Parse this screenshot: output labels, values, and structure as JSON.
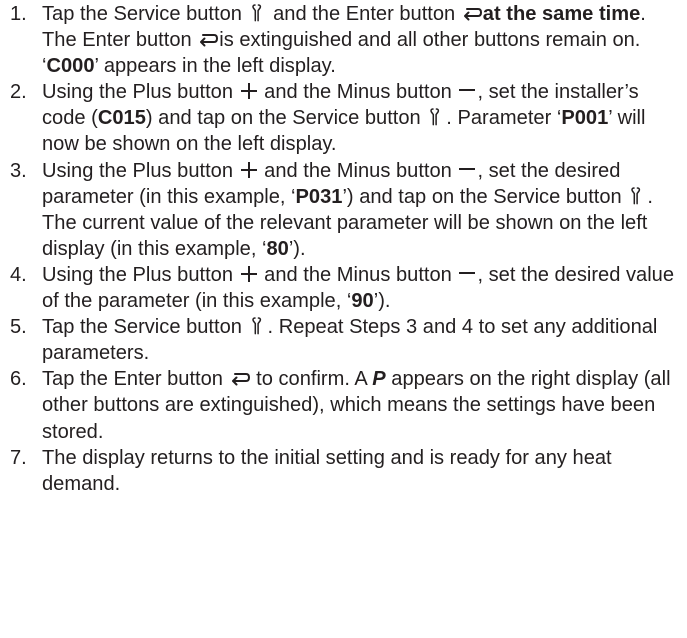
{
  "steps": [
    {
      "number": "1.",
      "parts": {
        "a": "Tap the Service button ",
        "b": " and the Enter button ",
        "c": "at the same time",
        "d": ". The Enter button ",
        "e": "is extinguished and all other buttons remain on. ‘",
        "f": "C000",
        "g": "’ appears in the left display."
      }
    },
    {
      "number": "2.",
      "parts": {
        "a": "Using the Plus button ",
        "b": " and the Minus button ",
        "c": ", set the installer’s code (",
        "d": "C015",
        "e": ") and tap on the Service button ",
        "f": ". Parameter ‘",
        "g": "P001",
        "h": "’ will now be shown on the left display."
      }
    },
    {
      "number": "3.",
      "parts": {
        "a": "Using the Plus button ",
        "b": " and the Minus button ",
        "c": ", set the desired parameter (in this example, ‘",
        "d": "P031",
        "e": "’) and tap on the Service button ",
        "f": ". The current value of the relevant parameter will be shown on the left display (in this example, ‘",
        "g": "80",
        "h": "’)."
      }
    },
    {
      "number": "4.",
      "parts": {
        "a": "Using the Plus button ",
        "b": " and the Minus button ",
        "c": ", set the desired value of the parameter (in this example, ‘",
        "d": "90",
        "e": "’)."
      }
    },
    {
      "number": "5.",
      "parts": {
        "a": "Tap the Service button ",
        "b": ". Repeat Steps 3 and 4 to set any additional parameters."
      }
    },
    {
      "number": "6.",
      "parts": {
        "a": "Tap the Enter button ",
        "b": " to confirm. A ",
        "c": "P",
        "d": " appears on the right display (all other buttons are extinguished), which means the settings have been stored."
      }
    },
    {
      "number": "7.",
      "parts": {
        "a": "The display returns to the initial setting and is ready for any heat demand."
      }
    }
  ],
  "icons": {
    "service": "service-wrench-icon",
    "enter": "enter-return-icon",
    "plus": "plus-icon",
    "minus": "minus-icon"
  },
  "colors": {
    "text": "#231f20"
  }
}
